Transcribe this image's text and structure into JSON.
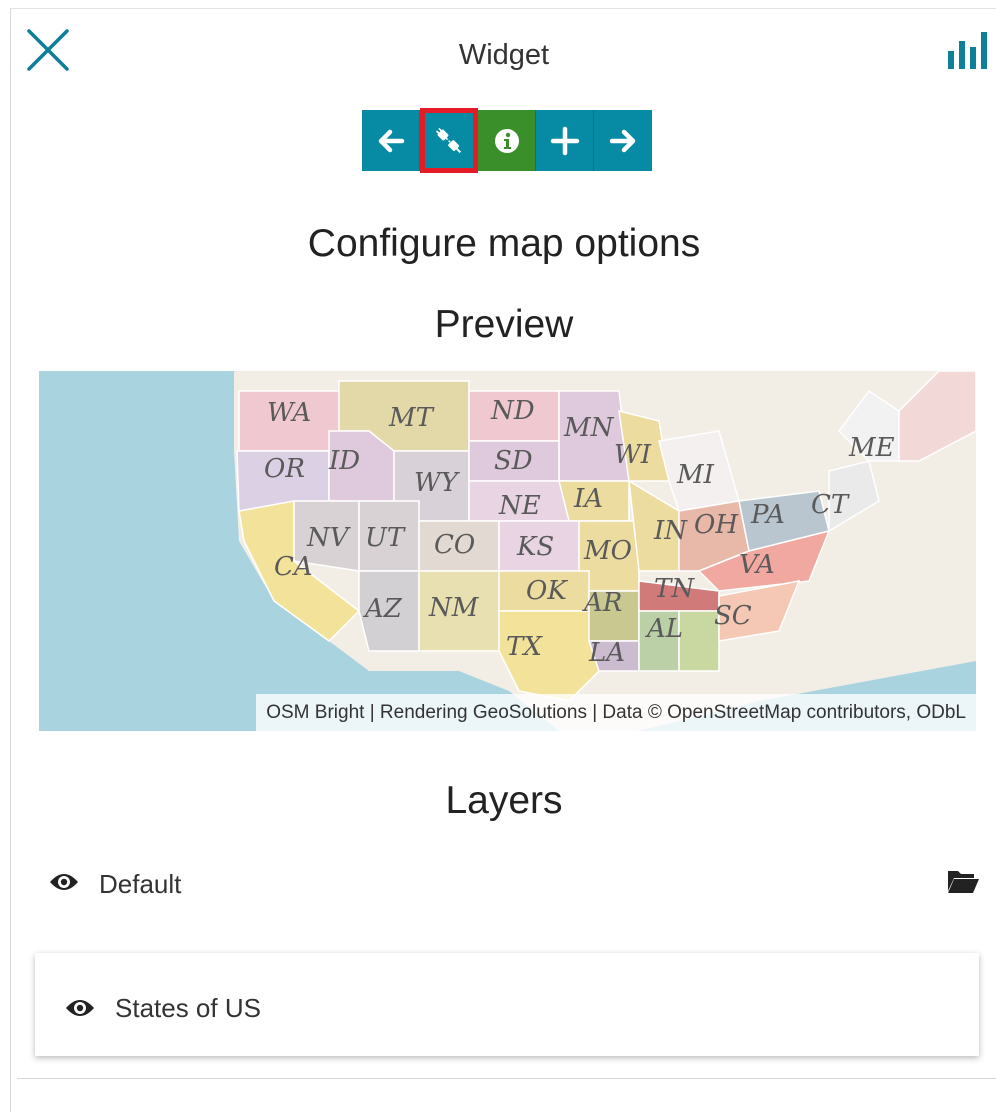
{
  "header": {
    "title": "Widget",
    "close_icon": "close-icon",
    "chart_icon": "bar-chart-icon"
  },
  "toolbar": {
    "buttons": [
      {
        "name": "back",
        "icon": "arrow-left-icon",
        "color": "#078aa3"
      },
      {
        "name": "connect",
        "icon": "plug-icon",
        "color": "#078aa3",
        "selected": true
      },
      {
        "name": "info",
        "icon": "info-icon",
        "color": "#3b8f2a"
      },
      {
        "name": "add",
        "icon": "plus-icon",
        "color": "#078aa3"
      },
      {
        "name": "next",
        "icon": "arrow-right-icon",
        "color": "#078aa3"
      }
    ]
  },
  "main": {
    "heading": "Configure map options",
    "preview_heading": "Preview",
    "map": {
      "attribution": "OSM Bright | Rendering GeoSolutions | Data © OpenStreetMap contributors, ODbL",
      "state_labels": [
        "WA",
        "MT",
        "ND",
        "MN",
        "ME",
        "OR",
        "ID",
        "SD",
        "WI",
        "MI",
        "WY",
        "NE",
        "IA",
        "PA",
        "CT",
        "NV",
        "UT",
        "CO",
        "KS",
        "MO",
        "IN",
        "OH",
        "VA",
        "CA",
        "OK",
        "AR",
        "TN",
        "AZ",
        "NM",
        "SC",
        "AL",
        "TX",
        "LA"
      ]
    },
    "layers_heading": "Layers",
    "group": {
      "label": "Default",
      "visible": true
    },
    "layers": [
      {
        "label": "States of US",
        "visible": true
      }
    ]
  }
}
